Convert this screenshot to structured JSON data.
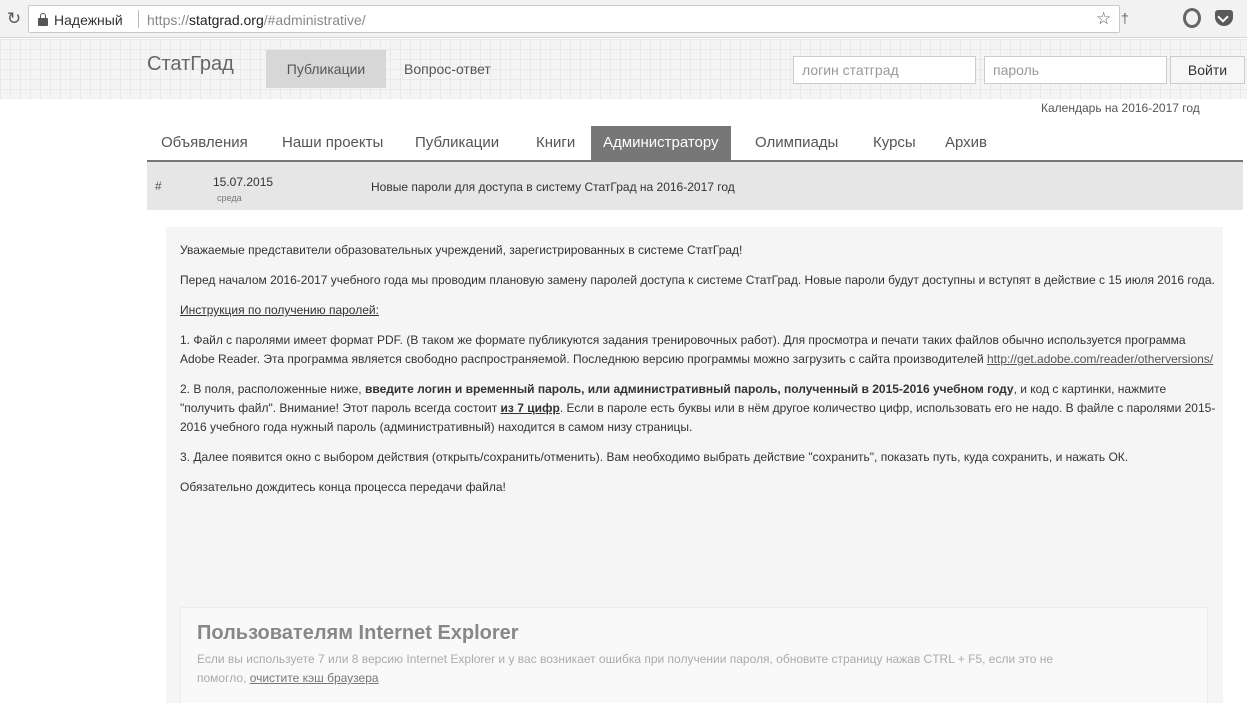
{
  "browser": {
    "secure_label": "Надежный",
    "url_scheme": "https://",
    "url_host": "statgrad.org",
    "url_path": "/#administrative/"
  },
  "site": {
    "brand": "СтатГрад",
    "nav": {
      "publications": "Публикации",
      "qa": "Вопрос-ответ"
    },
    "login": {
      "login_placeholder": "логин статград",
      "password_placeholder": "пароль",
      "submit_label": "Войти"
    },
    "calendar_link": "Календарь на 2016-2017 год"
  },
  "tabs": [
    {
      "label": "Объявления",
      "active": false
    },
    {
      "label": "Наши проекты",
      "active": false
    },
    {
      "label": "Публикации",
      "active": false
    },
    {
      "label": "Книги",
      "active": false
    },
    {
      "label": "Администратору",
      "active": true
    },
    {
      "label": "Олимпиады",
      "active": false
    },
    {
      "label": "Курсы",
      "active": false
    },
    {
      "label": "Архив",
      "active": false
    }
  ],
  "article": {
    "hash": "#",
    "date": "15.07.2015",
    "weekday": "среда",
    "title": "Новые пароли для доступа в систему СтатГрад на 2016-2017 год",
    "greeting": "Уважаемые представители образовательных учреждений, зарегистрированных в системе СтатГрад!",
    "intro": "Перед началом 2016-2017 учебного года мы проводим плановую замену паролей доступа к системе СтатГрад. Новые пароли будут доступны и вступят в действие с 15 июля 2016 года.",
    "instruction_heading": "Инструкция по получению паролей:",
    "step1_text": "1. Файл с паролями имеет формат PDF. (В таком же формате публикуются задания тренировочных работ). Для просмотра и печати таких файлов обычно используется программа Adobe Reader. Эта программа является свободно распространяемой. Последнюю версию программы можно загрузить с сайта производителей ",
    "step1_link": "http://get.adobe.com/reader/otherversions/",
    "step2_a": "2.  В поля, расположенные ниже, ",
    "step2_bold": "введите логин и временный пароль, или административный пароль, полученный в 2015-2016 учебном году",
    "step2_b": ", и код с картинки, нажмите \"получить файл\". Внимание! Этот пароль всегда состоит ",
    "step2_bold_u": "из 7 цифр",
    "step2_c": ". Если в пароле есть буквы или в нём другое количество цифр, использовать его не надо. В файле с паролями 2015-2016 учебного года нужный пароль (административный) находится в самом низу страницы.",
    "step3": "3. Далее появится окно с выбором действия (открыть/сохранить/отменить). Вам необходимо выбрать действие \"сохранить\", показать путь, куда сохранить, и нажать ОК.",
    "wait_note": "Обязательно дождитесь конца процесса передачи файла!",
    "ie_box": {
      "title": "Пользователям Internet Explorer",
      "text": "Если вы используете 7 или 8 версию Internet Explorer и у вас возникает ошибка при получении пароля, обновите страницу нажав CTRL + F5, если это не помогло, ",
      "link": "очистите кэш браузера"
    }
  }
}
